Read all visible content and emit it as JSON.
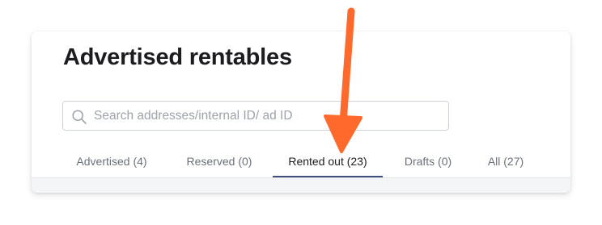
{
  "header": {
    "title": "Advertised rentables"
  },
  "search": {
    "placeholder": "Search addresses/internal ID/ ad ID",
    "value": "",
    "icon": "search-icon"
  },
  "tabs": [
    {
      "label": "Advertised (4)",
      "active": false
    },
    {
      "label": "Reserved (0)",
      "active": false
    },
    {
      "label": "Rented out (23)",
      "active": true
    },
    {
      "label": "Drafts (0)",
      "active": false
    },
    {
      "label": "All (27)",
      "active": false
    }
  ],
  "annotation": {
    "type": "arrow-down",
    "color": "#ff6a2c",
    "points_to": "Rented out (23)"
  },
  "colors": {
    "active_tab_underline": "#3d4f7a",
    "text_primary": "#1d1d1f",
    "text_muted": "#6b7079",
    "placeholder": "#9ea3aa"
  }
}
